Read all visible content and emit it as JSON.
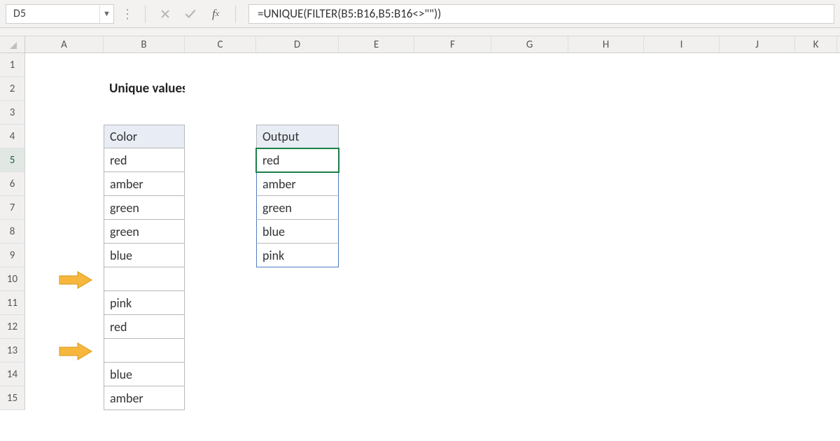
{
  "name_box": "D5",
  "formula": "=UNIQUE(FILTER(B5:B16,B5:B16<>\"\"))",
  "columns": [
    "A",
    "B",
    "C",
    "D",
    "E",
    "F",
    "G",
    "H",
    "I",
    "J",
    "K"
  ],
  "row_numbers": [
    "1",
    "2",
    "3",
    "4",
    "5",
    "6",
    "7",
    "8",
    "9",
    "10",
    "11",
    "12",
    "13",
    "14",
    "15"
  ],
  "title": "Unique values ignore blanks",
  "headers": {
    "color": "Color",
    "output": "Output"
  },
  "color_values": [
    "red",
    "amber",
    "green",
    "green",
    "blue",
    "",
    "pink",
    "red",
    "",
    "blue",
    "amber"
  ],
  "output_values": [
    "red",
    "amber",
    "green",
    "blue",
    "pink"
  ],
  "active_cell": "D5",
  "active_row": "5",
  "arrow_rows": [
    10,
    13
  ]
}
